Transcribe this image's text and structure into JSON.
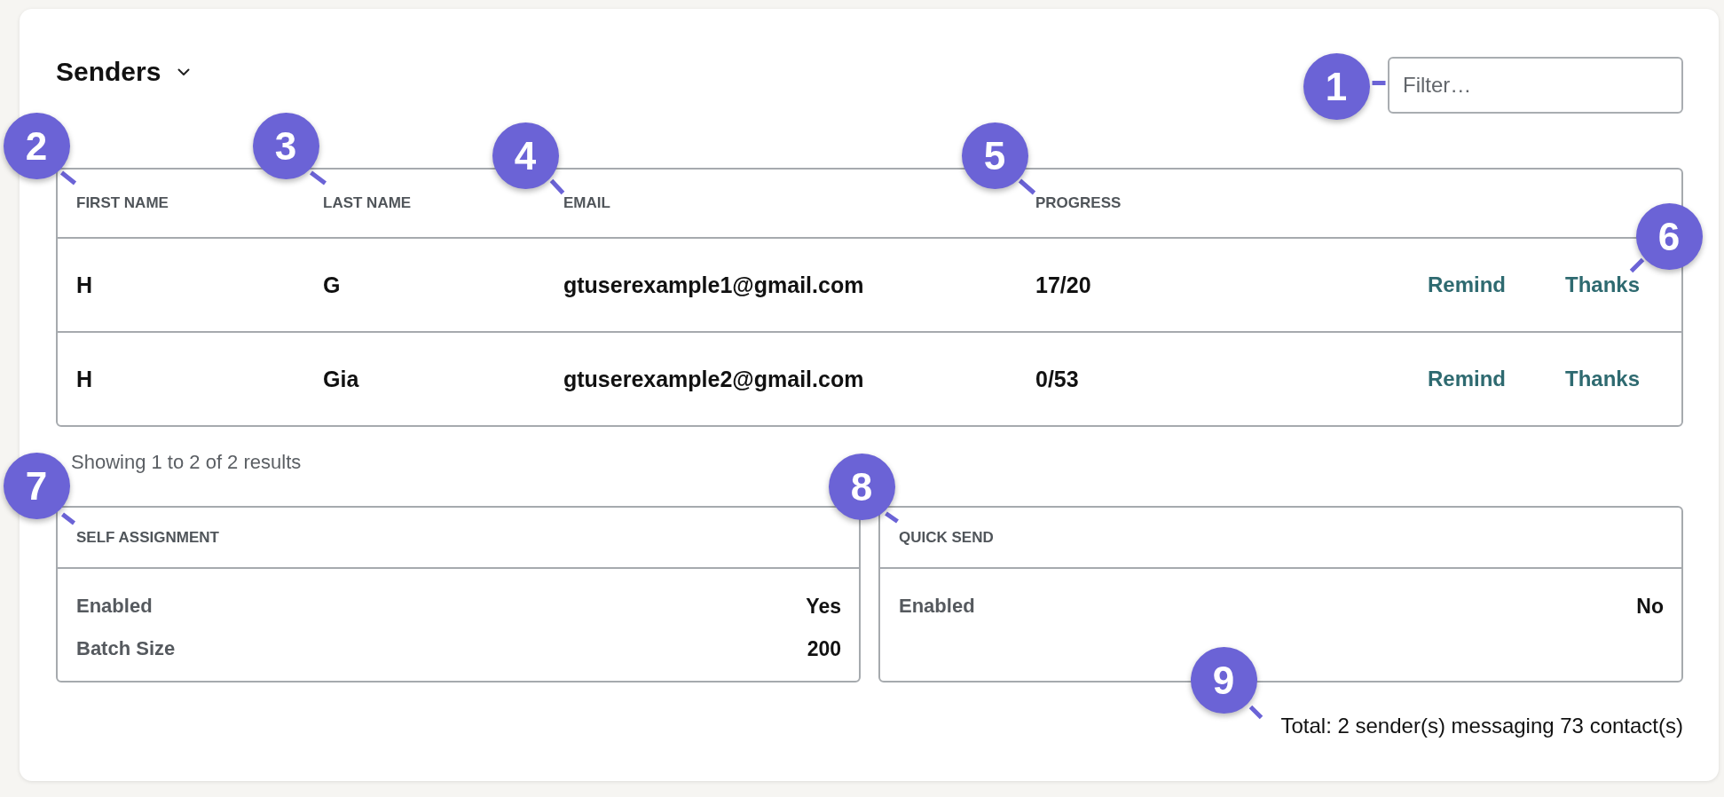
{
  "header": {
    "title": "Senders",
    "filter": {
      "placeholder": "Filter…"
    }
  },
  "table": {
    "columns": [
      "FIRST NAME",
      "LAST NAME",
      "EMAIL",
      "PROGRESS"
    ],
    "rows": [
      {
        "cells": [
          "H",
          "G",
          "gtuserexample1@gmail.com",
          "17/20"
        ],
        "actions": [
          "Remind",
          "Thanks"
        ]
      },
      {
        "cells": [
          "H",
          "Gia",
          "gtuserexample2@gmail.com",
          "0/53"
        ],
        "actions": [
          "Remind",
          "Thanks"
        ]
      }
    ]
  },
  "results_summary": "Showing 1 to 2 of 2 results",
  "panels": [
    {
      "title": "SELF ASSIGNMENT",
      "fields": [
        {
          "label": "Enabled",
          "value": "Yes"
        },
        {
          "label": "Batch Size",
          "value": "200"
        }
      ]
    },
    {
      "title": "QUICK SEND",
      "fields": [
        {
          "label": "Enabled",
          "value": "No"
        }
      ]
    }
  ],
  "total": "Total: 2 sender(s) messaging 73 contact(s)",
  "callouts": [
    {
      "label": "1"
    },
    {
      "label": "2"
    },
    {
      "label": "3"
    },
    {
      "label": "4"
    },
    {
      "label": "5"
    },
    {
      "label": "6"
    },
    {
      "label": "7"
    },
    {
      "label": "8"
    },
    {
      "label": "9"
    }
  ]
}
